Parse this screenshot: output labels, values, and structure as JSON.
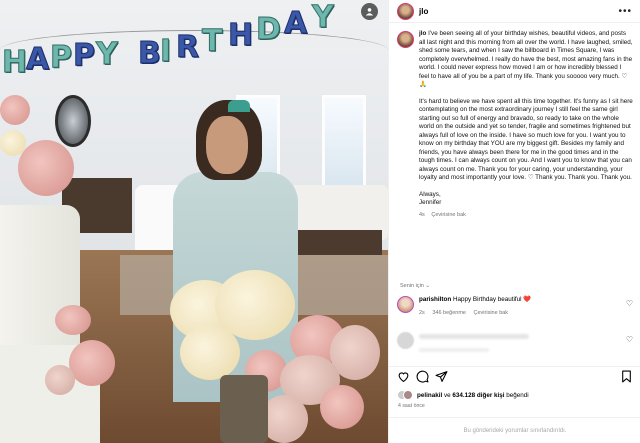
{
  "photo": {
    "banner_letters": [
      "H",
      "A",
      "P",
      "P",
      "Y",
      "B",
      "I",
      "R",
      "T",
      "H",
      "D",
      "A",
      "Y"
    ],
    "banner_colors": {
      "teal": "#6fb6ad",
      "blue": "#3b57a8"
    }
  },
  "post": {
    "username": "jlo",
    "more_label": "•••",
    "caption_username": "jlo",
    "caption_paragraphs": [
      "I've been seeing all of your birthday wishes, beautiful videos, and posts all last night and this morning from all over the world. I have laughed, smiled, shed some tears, and when I saw the billboard in Times Square, I was completely overwhelmed. I really do have the best, most amazing fans in the world. I could never express how moved I am or how incredibly blessed I feel to have all of you be a part of my life. Thank you sooooo very much. ♡🙏",
      "It's hard to believe we have spent all this time together. It's funny as I sit here contemplating on the most extraordinary journey I still feel the same girl starting out so full of energy and bravado, so ready to take on the whole world on the outside and yet so tender, fragile and sometimes frightened but always full of love on the inside. I have so much love for you. I want you to know on my birthday that YOU are my biggest gift. Besides my family and friends, you have always been there for me in the good times and in the tough times. I can always count on you. And I want you to know that you can always count on me. Thank you for your caring, your understanding, your loyalty and most importantly your love. ♡ Thank you. Thank you. Thank you.",
      "Always,\nJennifer"
    ],
    "caption_time": "4s",
    "caption_translate": "Çevirisine bak",
    "see_replies": "Senin için ⌄",
    "comments": [
      {
        "username": "parishilton",
        "text": "Happy Birthday beautiful ❤️",
        "time": "2s",
        "likes": "346 beğenme",
        "translate": "Çevirisine bak"
      }
    ],
    "likes_text": {
      "user": "pelinakil",
      "rest": " ve ",
      "count": "634.128 diğer kişi",
      "suffix": " beğendi"
    },
    "time_ago": "4 saat önce",
    "comments_off": "Bu gönderideki yorumlar sınırlandırıldı."
  }
}
